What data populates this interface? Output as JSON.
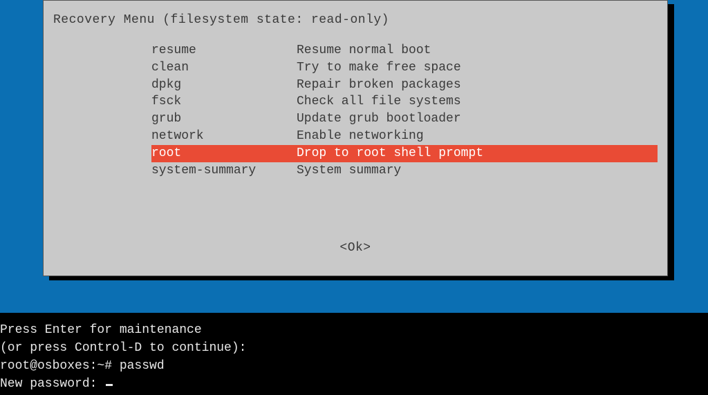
{
  "dialog": {
    "title": "Recovery Menu (filesystem state: read-only)",
    "ok_label": "<Ok>",
    "selected_index": 6,
    "items": [
      {
        "key": "resume",
        "desc": "Resume normal boot"
      },
      {
        "key": "clean",
        "desc": "Try to make free space"
      },
      {
        "key": "dpkg",
        "desc": "Repair broken packages"
      },
      {
        "key": "fsck",
        "desc": "Check all file systems"
      },
      {
        "key": "grub",
        "desc": "Update grub bootloader"
      },
      {
        "key": "network",
        "desc": "Enable networking"
      },
      {
        "key": "root",
        "desc": "Drop to root shell prompt"
      },
      {
        "key": "system-summary",
        "desc": "System summary"
      }
    ]
  },
  "terminal": {
    "lines": [
      "Press Enter for maintenance",
      "(or press Control-D to continue):",
      "root@osboxes:~# passwd",
      "New password: "
    ]
  }
}
